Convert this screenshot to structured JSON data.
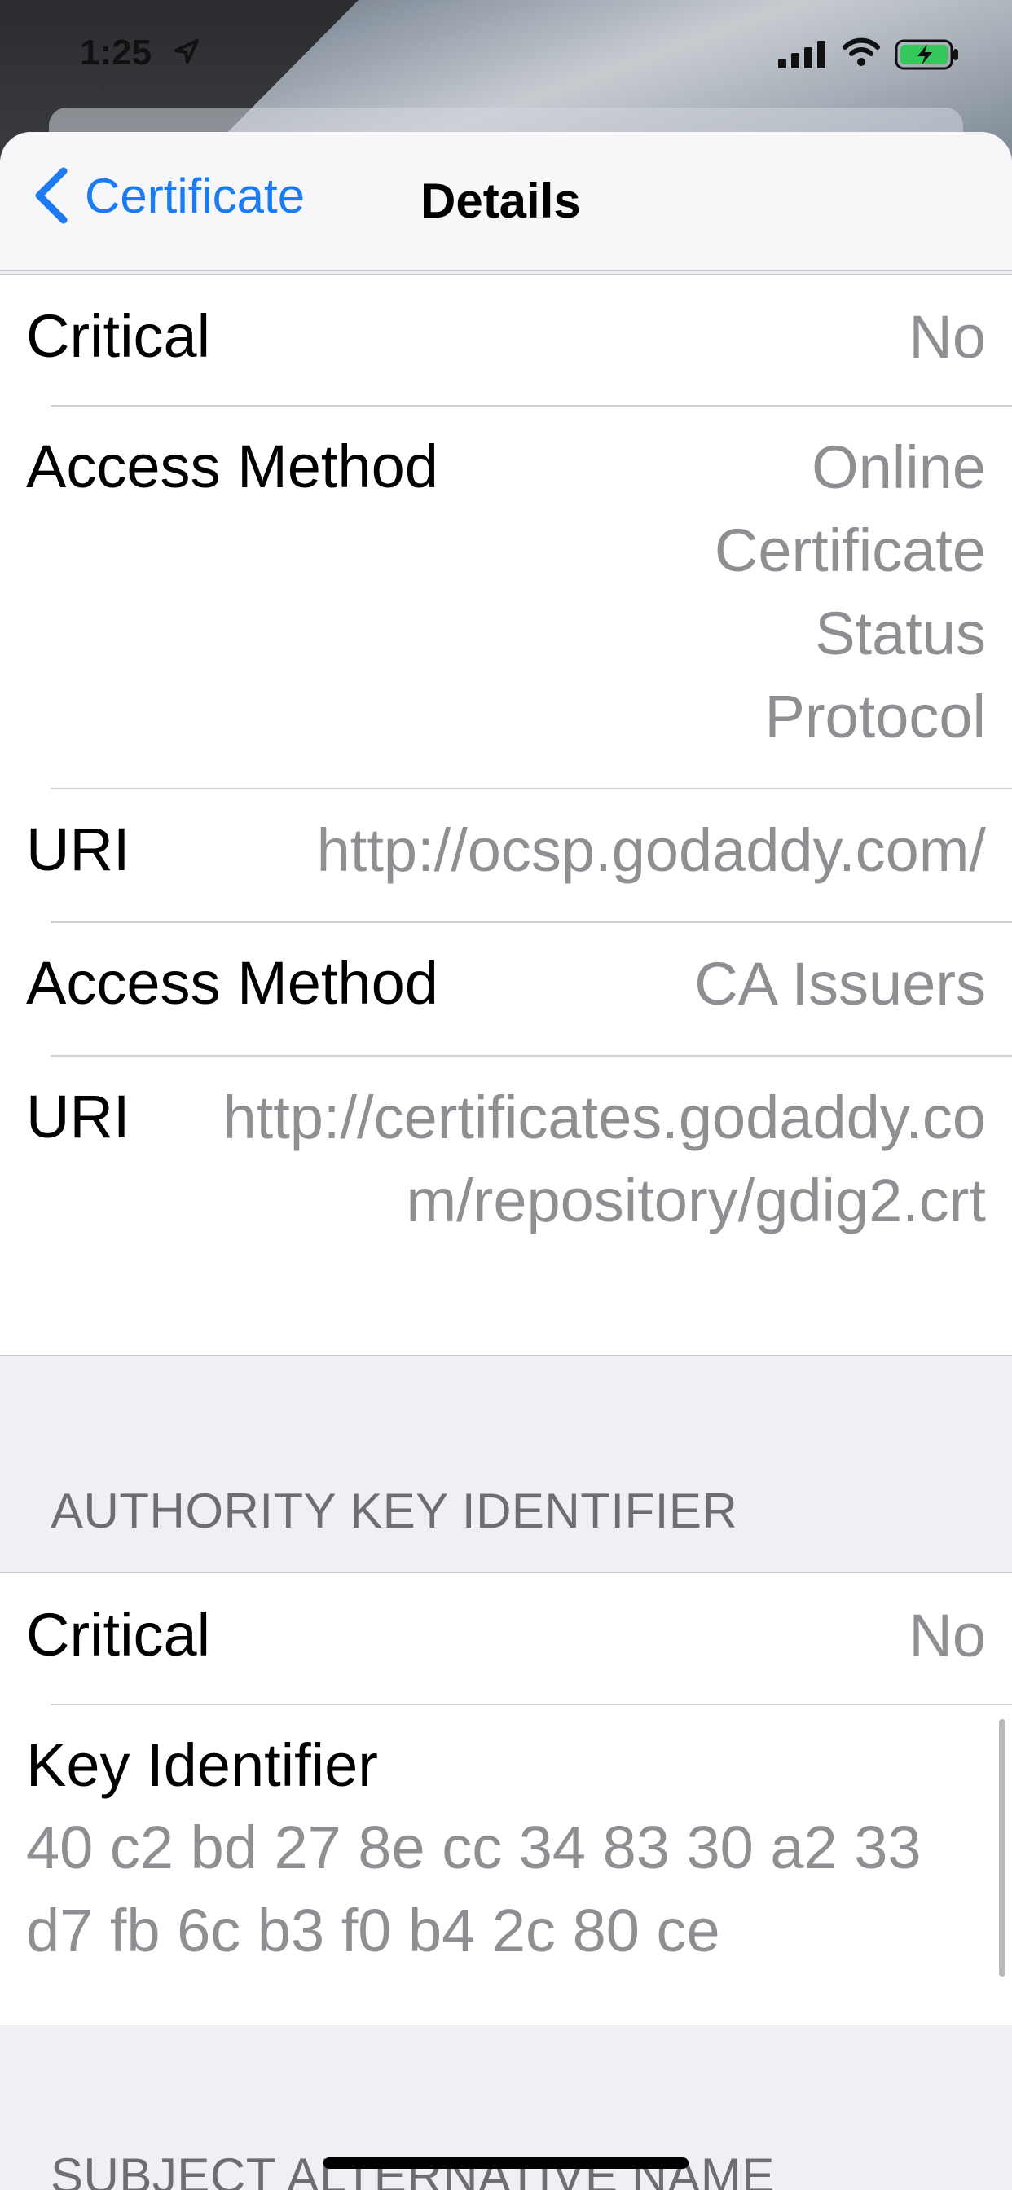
{
  "status_bar": {
    "time": "1:25"
  },
  "nav": {
    "back_label": "Certificate",
    "title": "Details"
  },
  "aia_group": {
    "rows": [
      {
        "label": "Critical",
        "value": "No"
      },
      {
        "label": "Access Method",
        "value": "Online Certificate Status Protocol"
      },
      {
        "label": "URI",
        "value": "http://ocsp.godaddy.com/"
      },
      {
        "label": "Access Method",
        "value": "CA Issuers"
      },
      {
        "label": "URI",
        "value": "http://certificates.godaddy.com/repository/gdig2.crt"
      }
    ]
  },
  "authority_key_section": {
    "header": "AUTHORITY KEY IDENTIFIER",
    "rows": [
      {
        "label": "Critical",
        "value": "No"
      },
      {
        "label": "Key Identifier",
        "value": "40 c2 bd 27 8e cc 34 83 30 a2 33 d7 fb 6c b3 f0 b4 2c 80 ce"
      }
    ]
  },
  "next_section": {
    "header": "SUBJECT ALTERNATIVE NAME"
  }
}
